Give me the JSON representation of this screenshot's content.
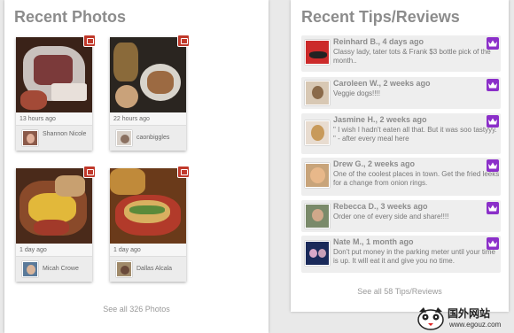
{
  "photos": {
    "title": "Recent Photos",
    "see_all": "See all 326 Photos",
    "items": [
      {
        "time": "13 hours ago",
        "user": "Shannon Nicole"
      },
      {
        "time": "22 hours ago",
        "user": "caonbiggles"
      },
      {
        "time": "1 day ago",
        "user": "Micah Crowe"
      },
      {
        "time": "1 day ago",
        "user": "Dallas Alcala"
      }
    ]
  },
  "tips": {
    "title": "Recent Tips/Reviews",
    "see_all": "See all 58 Tips/Reviews",
    "items": [
      {
        "author": "Reinhard B., 4 days ago",
        "text": "Classy lady, tater tots & Frank $3 bottle pick of the month.."
      },
      {
        "author": "Caroleen W., 2 weeks ago",
        "text": "Veggie dogs!!!!"
      },
      {
        "author": "Jasmine H., 2 weeks ago",
        "text": "\" I wish I hadn't eaten all that. But it was soo tastyyy. \" - after every meal here"
      },
      {
        "author": "Drew G., 2 weeks ago",
        "text": "One of the coolest places in town. Get the fried leeks for a change from onion rings."
      },
      {
        "author": "Rebecca D., 3 weeks ago",
        "text": "Order one of every side and share!!!!"
      },
      {
        "author": "Nate M., 1 month ago",
        "text": "Don't put money in the parking meter until your time is up. It will eat it and give you no time."
      }
    ]
  },
  "watermark": {
    "text": "国外网站",
    "url": "www.egouz.com"
  },
  "colors": {
    "crown_badge": "#8b2fc9",
    "camera_badge": "#c0392b",
    "title_gray": "#8c8c8c"
  }
}
